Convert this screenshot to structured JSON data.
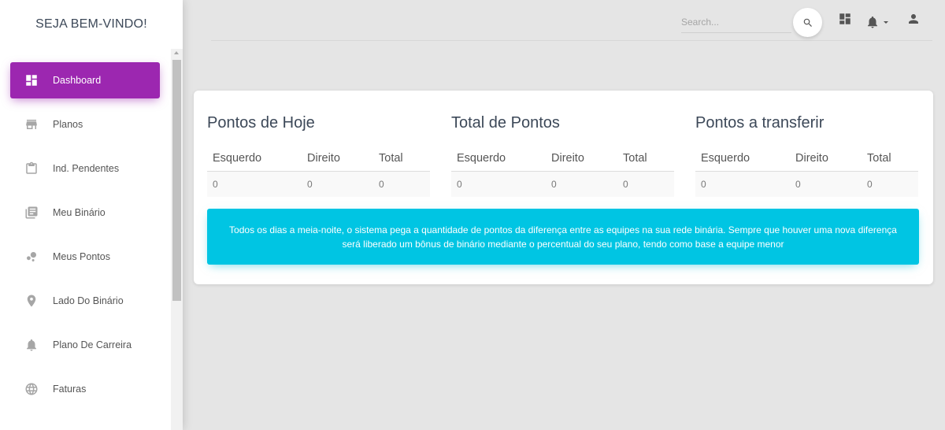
{
  "brand": "SEJA BEM-VINDO!",
  "sidebar": {
    "items": [
      {
        "label": "Dashboard",
        "icon": "dashboard-icon",
        "active": true
      },
      {
        "label": "Planos",
        "icon": "store-icon"
      },
      {
        "label": "Ind. Pendentes",
        "icon": "clipboard-icon"
      },
      {
        "label": "Meu Binário",
        "icon": "library-books-icon"
      },
      {
        "label": "Meus Pontos",
        "icon": "bubble-chart-icon"
      },
      {
        "label": "Lado Do Binário",
        "icon": "location-pin-icon"
      },
      {
        "label": "Plano De Carreira",
        "icon": "bell-icon"
      },
      {
        "label": "Faturas",
        "icon": "globe-icon"
      }
    ]
  },
  "topbar": {
    "search_placeholder": "Search..."
  },
  "sections": [
    {
      "title": "Pontos de Hoje",
      "headers": [
        "Esquerdo",
        "Direito",
        "Total"
      ],
      "row": [
        "0",
        "0",
        "0"
      ]
    },
    {
      "title": "Total de Pontos",
      "headers": [
        "Esquerdo",
        "Direito",
        "Total"
      ],
      "row": [
        "0",
        "0",
        "0"
      ]
    },
    {
      "title": "Pontos a transferir",
      "headers": [
        "Esquerdo",
        "Direito",
        "Total"
      ],
      "row": [
        "0",
        "0",
        "0"
      ]
    }
  ],
  "info_text": "Todos os dias a meia-noite, o sistema pega a quantidade de pontos da diferença entre as equipes na sua rede binária. Sempre que houver uma nova diferença será liberado um bônus de binário mediante o percentual do seu plano, tendo como base a equipe menor",
  "colors": {
    "accent": "#9c27b0",
    "info": "#00c5e3",
    "background": "#e5e5e5"
  }
}
